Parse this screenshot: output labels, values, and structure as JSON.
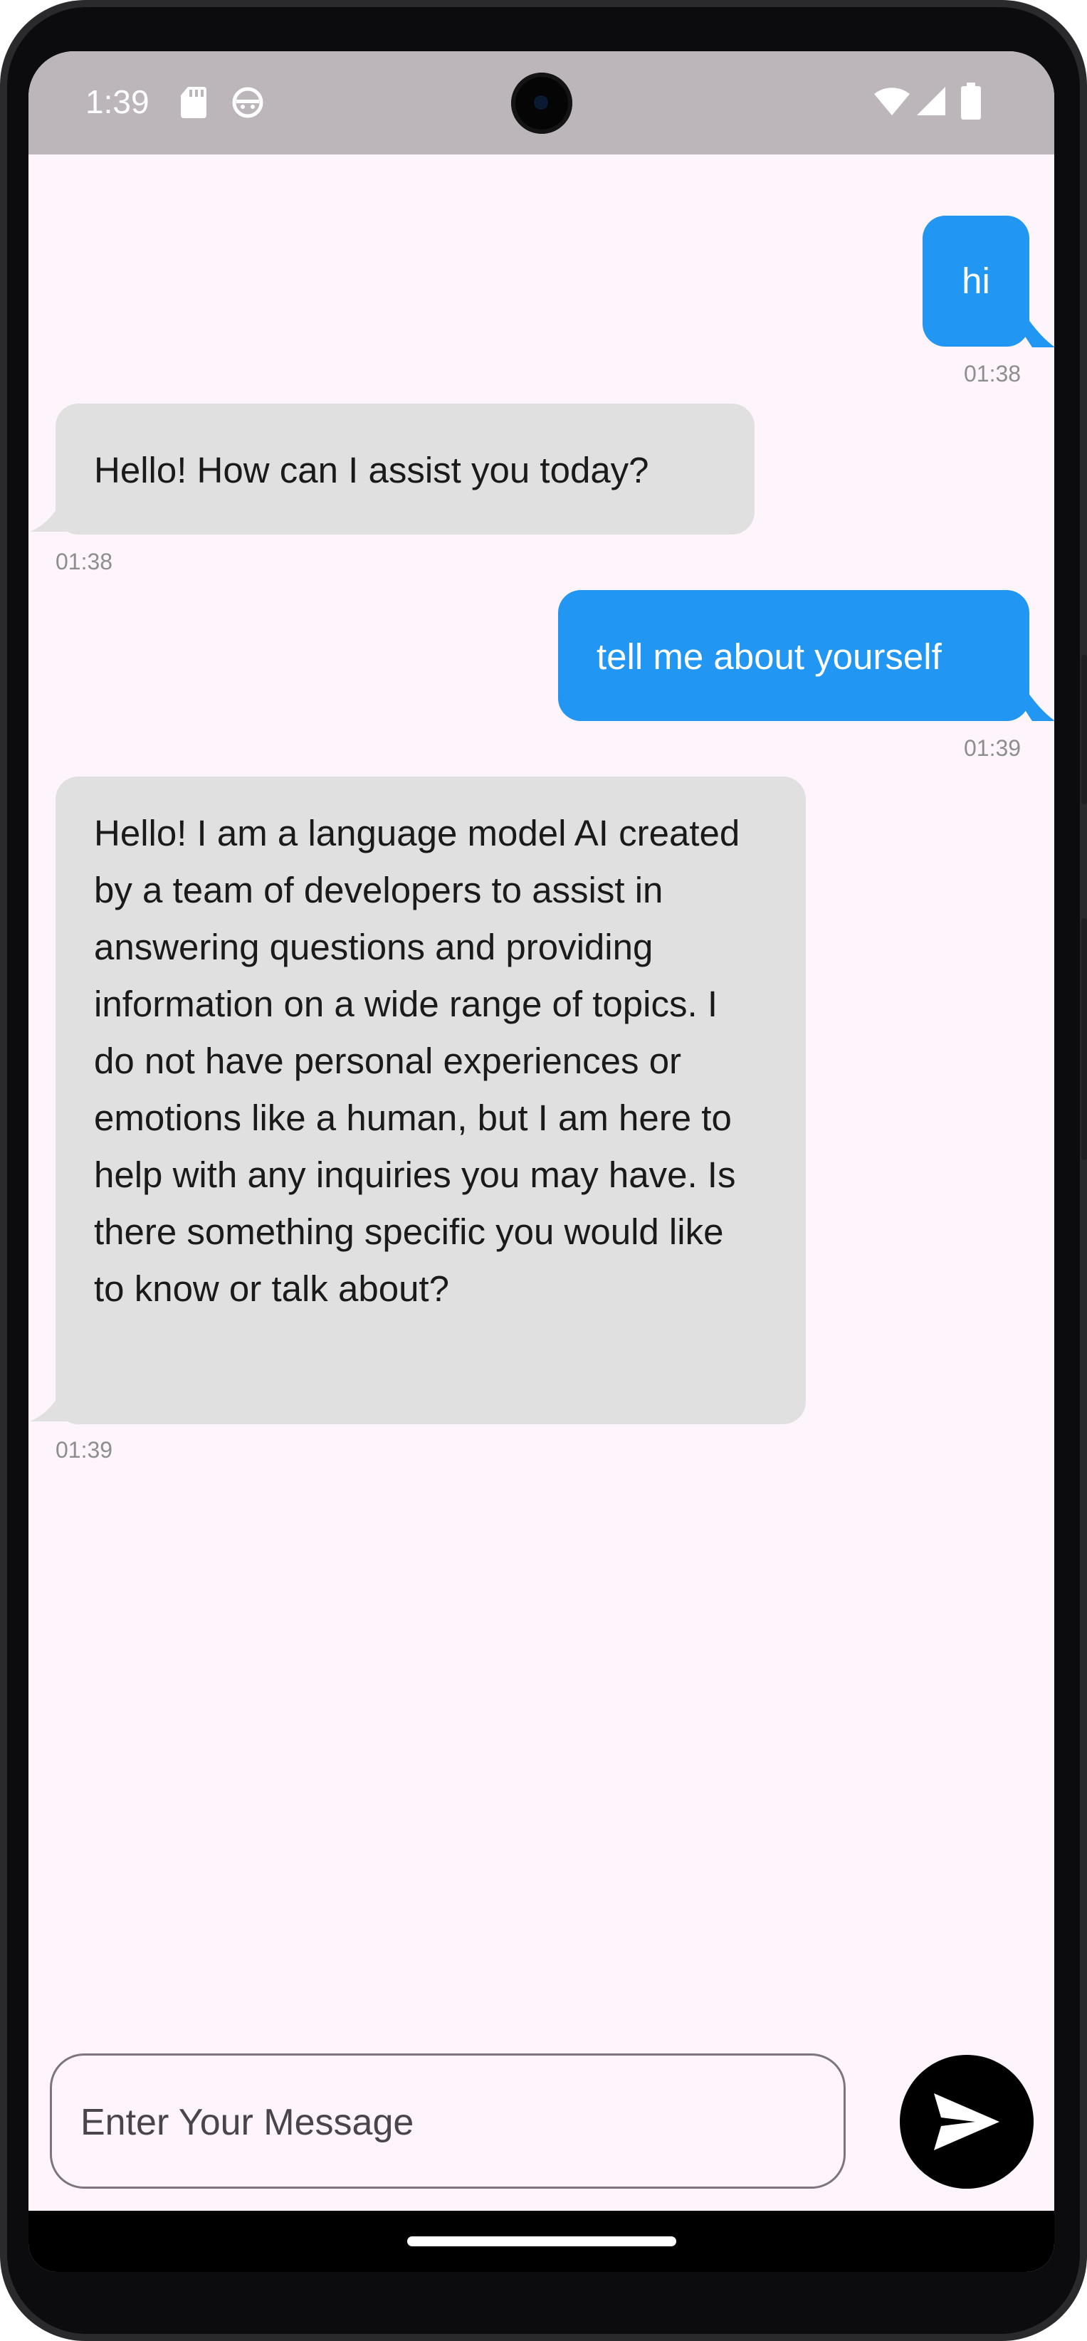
{
  "status_bar": {
    "time": "1:39",
    "icons": [
      "sd-card-icon",
      "android-head-icon",
      "wifi-icon",
      "cellular-signal-icon",
      "battery-icon"
    ]
  },
  "messages": [
    {
      "sender": "user",
      "text": "hi",
      "time": "01:38"
    },
    {
      "sender": "bot",
      "text": "Hello! How can I assist you today?",
      "time": "01:38"
    },
    {
      "sender": "user",
      "text": "tell me about yourself",
      "time": "01:39"
    },
    {
      "sender": "bot",
      "text": "Hello! I am a language model AI created by a team of developers to assist in answering questions and providing information on a wide range of topics. I do not have personal experiences or emotions like a human, but I am here to help with any inquiries you may have. Is there something specific you would like to know or talk about?",
      "time": "01:39"
    }
  ],
  "composer": {
    "placeholder": "Enter Your Message",
    "send_icon": "send-icon"
  },
  "colors": {
    "user_bubble": "#2196f3",
    "bot_bubble": "#e0e0e0",
    "chat_background": "#fdf5fb",
    "status_bar": "#bcb6bb",
    "send_button": "#000000"
  }
}
